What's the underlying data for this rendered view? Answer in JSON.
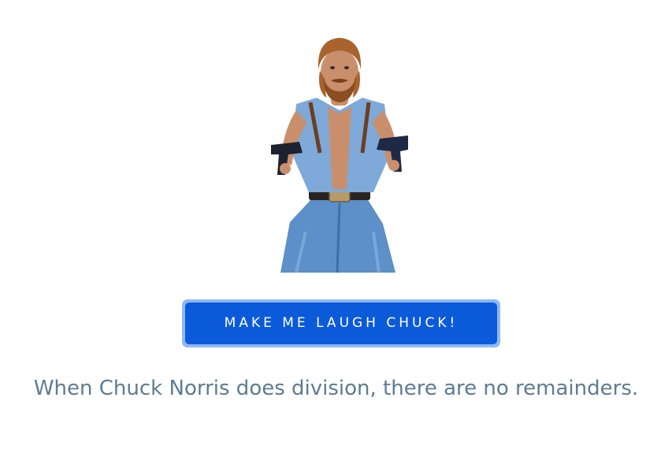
{
  "hero_image": {
    "description_icon": "chuck-norris-portrait"
  },
  "action": {
    "button_label": "MAKE ME LAUGH CHUCK!"
  },
  "joke": {
    "text": "When Chuck Norris does division, there are no remainders."
  },
  "colors": {
    "button_bg": "#0b5ad9",
    "button_ring": "#90b7f5",
    "button_text": "#ffffff",
    "joke_text": "#5d7b94",
    "background": "#ffffff"
  }
}
